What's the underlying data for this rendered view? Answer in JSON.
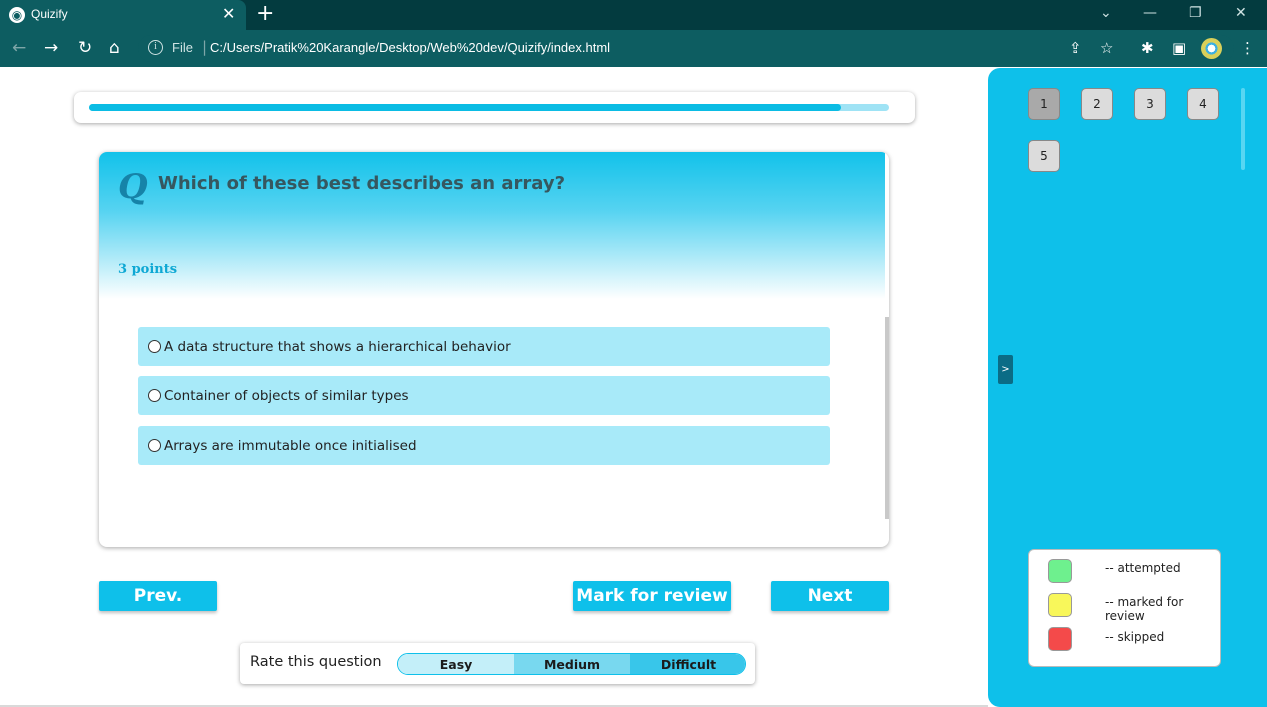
{
  "browser": {
    "tab_title": "Quizify",
    "tab_close": "✕",
    "new_tab": "+",
    "window_controls": [
      "⌄",
      "—",
      "❐",
      "✕"
    ],
    "nav": {
      "back": "←",
      "forward": "→",
      "reload": "↻",
      "home": "⌂"
    },
    "address": {
      "info_icon": "i",
      "scheme_label": "File",
      "separator": "|",
      "url": "C:/Users/Pratik%20Karangle/Desktop/Web%20dev/Quizify/index.html"
    },
    "toolbar_icons": {
      "share": "⇪",
      "star": "☆",
      "extensions": "✱",
      "sidepanel": "▣",
      "menu": "⋮"
    }
  },
  "progress": {
    "fraction": 0.94
  },
  "question": {
    "logo": "Q",
    "text": "Which of these best describes an array?",
    "points": "3 points",
    "options": [
      {
        "label": "A data structure that shows a hierarchical behavior"
      },
      {
        "label": "Container of objects of similar types"
      },
      {
        "label": "Arrays are immutable once initialised"
      }
    ]
  },
  "buttons": {
    "prev": "Prev.",
    "mark_review": "Mark for review",
    "next": "Next"
  },
  "rating": {
    "label": "Rate this question",
    "options": [
      "Easy",
      "Medium",
      "Difficult"
    ]
  },
  "sidebar": {
    "question_numbers": [
      "1",
      "2",
      "3",
      "4",
      "5"
    ],
    "current": "1",
    "toggle_label": ">",
    "legend": [
      {
        "color": "#6ef08e",
        "label": "-- attempted"
      },
      {
        "color": "#f8f75a",
        "label": "-- marked for review"
      },
      {
        "color": "#f44a4a",
        "label": "-- skipped"
      }
    ]
  },
  "colors": {
    "accent": "#0ec0ea",
    "option_bg": "#a8eaf9",
    "chrome_bg": "#0d5d61"
  }
}
